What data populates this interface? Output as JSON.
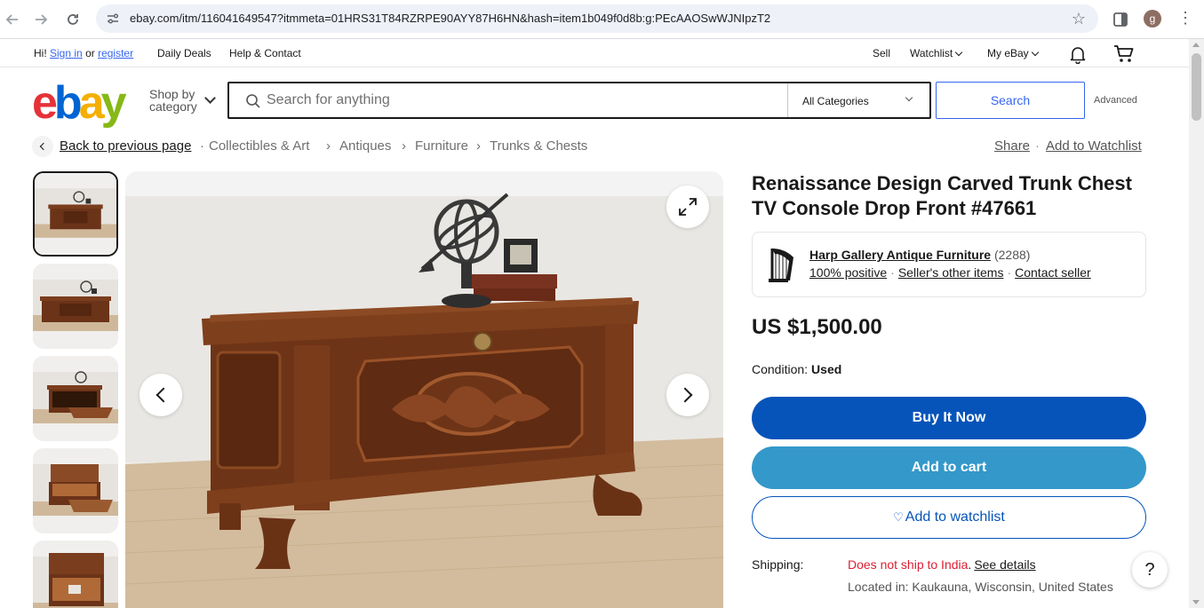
{
  "browser": {
    "url": "ebay.com/itm/116041649547?itmmeta=01HRS31T84RZRPE90AYY87H6HN&hash=item1b049f0d8b:g:PEcAAOSwWJNIpzT2",
    "profile_initial": "g"
  },
  "toplinks": {
    "greeting": "Hi!",
    "sign_in": "Sign in",
    "or": "or",
    "register": "register",
    "daily_deals": "Daily Deals",
    "help_contact": "Help & Contact",
    "sell": "Sell",
    "watchlist": "Watchlist",
    "my_ebay": "My eBay"
  },
  "header": {
    "logo_letters": [
      "e",
      "b",
      "a",
      "y"
    ],
    "shop_by_line1": "Shop by",
    "shop_by_line2": "category",
    "search_placeholder": "Search for anything",
    "category": "All Categories",
    "search_button": "Search",
    "advanced": "Advanced"
  },
  "breadcrumb": {
    "back": "Back to previous page",
    "items": [
      "Collectibles & Art",
      "Antiques",
      "Furniture",
      "Trunks & Chests"
    ],
    "share": "Share",
    "add_watchlist": "Add to Watchlist"
  },
  "listing": {
    "title": "Renaissance Design Carved Trunk Chest TV Console Drop Front #47661",
    "seller": {
      "name": "Harp Gallery Antique Furniture",
      "feedback_count": "(2288)",
      "positive": "100% positive",
      "other_items": "Seller's other items",
      "contact": "Contact seller"
    },
    "price": "US $1,500.00",
    "condition_label": "Condition:",
    "condition_value": "Used",
    "buy_now": "Buy It Now",
    "add_to_cart": "Add to cart",
    "add_to_watchlist": "Add to watchlist",
    "shipping_label": "Shipping:",
    "shipping_value": "Does not ship to India",
    "shipping_dot": ".",
    "see_details": "See details",
    "located": "Located in: Kaukauna, Wisconsin, United States"
  },
  "help": "?",
  "colors": {
    "buy_now": "#0654ba",
    "add_to_cart": "#3498ca",
    "shipping_warning": "#dd1e31",
    "search_button": "#3665f3"
  }
}
